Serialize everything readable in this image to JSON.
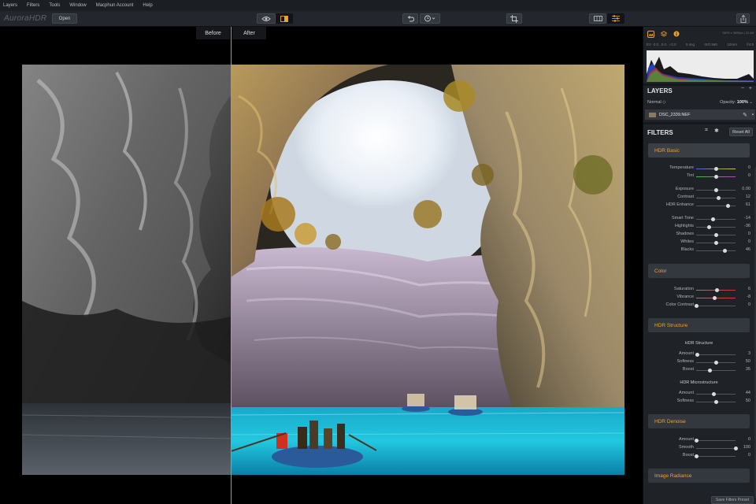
{
  "menu": [
    "Layers",
    "Filters",
    "Tools",
    "Window",
    "Macphun Account",
    "Help"
  ],
  "toolbar": {
    "app_logo": "AuroraHDR",
    "open_label": "Open",
    "preview_icon": "eye-icon",
    "compare_icon": "split-compare-icon",
    "undo_icon": "undo-icon",
    "history_icon": "history-clock-icon",
    "crop_icon": "crop-icon",
    "presets_icon": "presets-icon",
    "adjust_icon": "sliders-icon",
    "share_icon": "share-icon"
  },
  "canvas": {
    "before_label": "Before",
    "after_label": "After"
  },
  "panel": {
    "exif_top": "5875 x 3905px  |  32-bit",
    "exif_stats": [
      "EV -2.0...0.0...+2.0",
      "5 img",
      "ISO 560",
      "10mm",
      "f/4.5"
    ],
    "layers_title": "LAYERS",
    "blend_mode": "Normal",
    "opacity_label": "Opacity:",
    "opacity_value": "100%",
    "layer_name": "DSC_2339.NEF",
    "filters_title": "FILTERS",
    "reset_all": "Reset All",
    "save_preset": "Save Filters Preset"
  },
  "filters": {
    "hdr_basic": {
      "title": "HDR Basic",
      "sliders": [
        {
          "label": "Temperature",
          "value": "0",
          "pos": 0.5
        },
        {
          "label": "Tint",
          "value": "0",
          "pos": 0.5
        },
        {
          "label": "Exposure",
          "value": "0.00",
          "pos": 0.5
        },
        {
          "label": "Contrast",
          "value": "12",
          "pos": 0.56
        },
        {
          "label": "HDR Enhance",
          "value": "61",
          "pos": 0.81
        },
        {
          "label": "Smart Tone",
          "value": "-14",
          "pos": 0.43
        },
        {
          "label": "Highlights",
          "value": "-36",
          "pos": 0.32
        },
        {
          "label": "Shadows",
          "value": "0",
          "pos": 0.5
        },
        {
          "label": "Whites",
          "value": "0",
          "pos": 0.5
        },
        {
          "label": "Blacks",
          "value": "46",
          "pos": 0.73
        }
      ]
    },
    "color": {
      "title": "Color",
      "sliders": [
        {
          "label": "Saturation",
          "value": "6",
          "pos": 0.53
        },
        {
          "label": "Vibrance",
          "value": "-8",
          "pos": 0.46
        },
        {
          "label": "Color Contrast",
          "value": "0",
          "pos": 0.0
        }
      ]
    },
    "hdr_structure": {
      "title": "HDR Structure",
      "sub1": "HDR Structure",
      "sliders1": [
        {
          "label": "Amount",
          "value": "3",
          "pos": 0.03
        },
        {
          "label": "Softness",
          "value": "50",
          "pos": 0.5
        },
        {
          "label": "Boost",
          "value": "35",
          "pos": 0.35
        }
      ],
      "sub2": "HDR Microstructure",
      "sliders2": [
        {
          "label": "Amount",
          "value": "44",
          "pos": 0.44
        },
        {
          "label": "Softness",
          "value": "50",
          "pos": 0.5
        }
      ]
    },
    "hdr_denoise": {
      "title": "HDR Denoise",
      "sliders": [
        {
          "label": "Amount",
          "value": "0",
          "pos": 0.0
        },
        {
          "label": "Smooth",
          "value": "100",
          "pos": 1.0
        },
        {
          "label": "Boost",
          "value": "0",
          "pos": 0.0
        }
      ]
    },
    "image_radiance": {
      "title": "Image Radiance"
    }
  }
}
